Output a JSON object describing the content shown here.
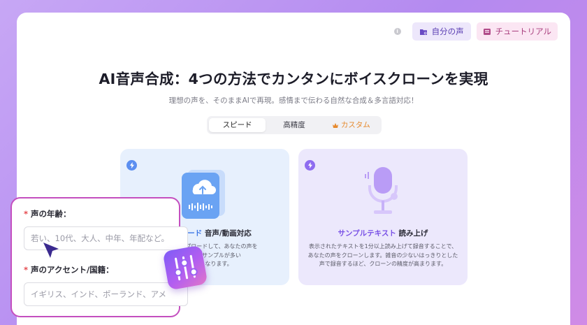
{
  "header": {
    "info_icon": "info-icon",
    "my_voice_label": "自分の声",
    "tutorial_label": "チュートリアル"
  },
  "hero": {
    "title": "AI音声合成：4つの方法でカンタンにボイスクローンを実現",
    "subtitle": "理想の声を、そのままAIで再現。感情まで伝わる自然な合成＆多言語対応！"
  },
  "tabs": [
    {
      "label": "スピード",
      "active": true
    },
    {
      "label": "高精度",
      "active": false
    },
    {
      "label": "カスタム",
      "active": false,
      "icon": "crown-icon"
    }
  ],
  "cards": {
    "upload": {
      "title_highlight": "アップロード",
      "title_rest": " 音声/動画対応",
      "description": "ンプルをアップロードして、あなたの声を\n時で提供するサンプルが多い\n品質が高くなります。"
    },
    "sample": {
      "title_highlight": "サンプルテキスト",
      "title_rest": " 読み上げ",
      "description": "表示されたテキストを1分以上読み上げて録音することで、あなたの声をクローンします。雑音の少ないはっきりとした声で録音するほど、クローンの精度が高まります。"
    }
  },
  "form": {
    "age_label": "声の年齢：",
    "age_placeholder": "若い、10代、大人、中年、年配など。",
    "accent_label": "声のアクセント/国籍：",
    "accent_placeholder": "イギリス、インド、ポーランド、アメ",
    "required_mark": "*"
  },
  "colors": {
    "accent_purple": "#7a52e6",
    "accent_blue": "#3e78e6",
    "overlay_border": "#c44fbf",
    "custom_tab": "#e68a2e"
  }
}
